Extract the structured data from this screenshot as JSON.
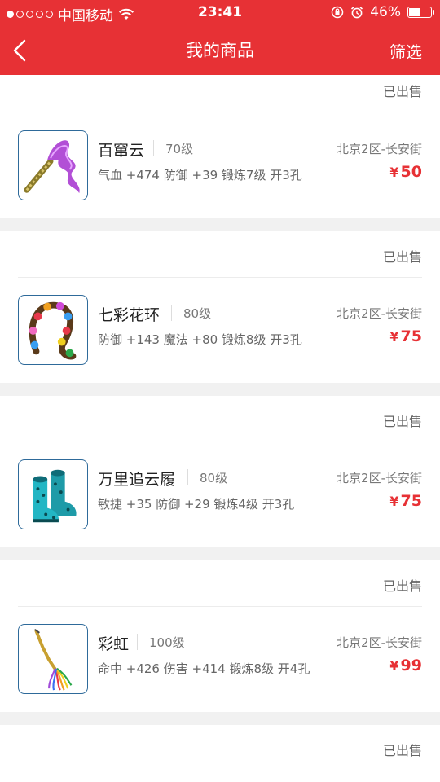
{
  "status_bar": {
    "carrier": "中国移动",
    "time": "23:41",
    "battery_pct": "46%",
    "icons": [
      "signal-dots-icon",
      "wifi-icon",
      "rotation-lock-icon",
      "alarm-icon",
      "battery-icon"
    ]
  },
  "nav": {
    "title": "我的商品",
    "filter_label": "筛选",
    "back_icon": "chevron-left-icon"
  },
  "items": [
    {
      "name": "百窜云",
      "level": "70级",
      "server": "北京2区-长安街",
      "attrs": "气血 +474 防御 +39 锻炼7级 开3孔",
      "price": "50",
      "currency": "¥",
      "thumb_icon": "purple-ribbon-weapon-icon"
    },
    {
      "status": "已出售",
      "name": "七彩花环",
      "level": "80级",
      "server": "北京2区-长安街",
      "attrs": "防御 +143 魔法 +80 锻炼8级 开3孔",
      "price": "75",
      "currency": "¥",
      "thumb_icon": "flower-garland-icon"
    },
    {
      "status": "已出售",
      "name": "万里追云履",
      "level": "80级",
      "server": "北京2区-长安街",
      "attrs": "敏捷 +35 防御 +29 锻炼4级 开3孔",
      "price": "75",
      "currency": "¥",
      "thumb_icon": "cyan-boots-icon"
    },
    {
      "status": "已出售",
      "name": "彩虹",
      "level": "100级",
      "server": "北京2区-长安街",
      "attrs": "命中 +426 伤害 +414 锻炼8级 开4孔",
      "price": "99",
      "currency": "¥",
      "thumb_icon": "rainbow-whip-icon"
    }
  ],
  "top_status": "已出售",
  "last_status": "已出售",
  "colors": {
    "brand": "#e73135",
    "price": "#e73135",
    "thumb_border": "#2e6a9a"
  }
}
